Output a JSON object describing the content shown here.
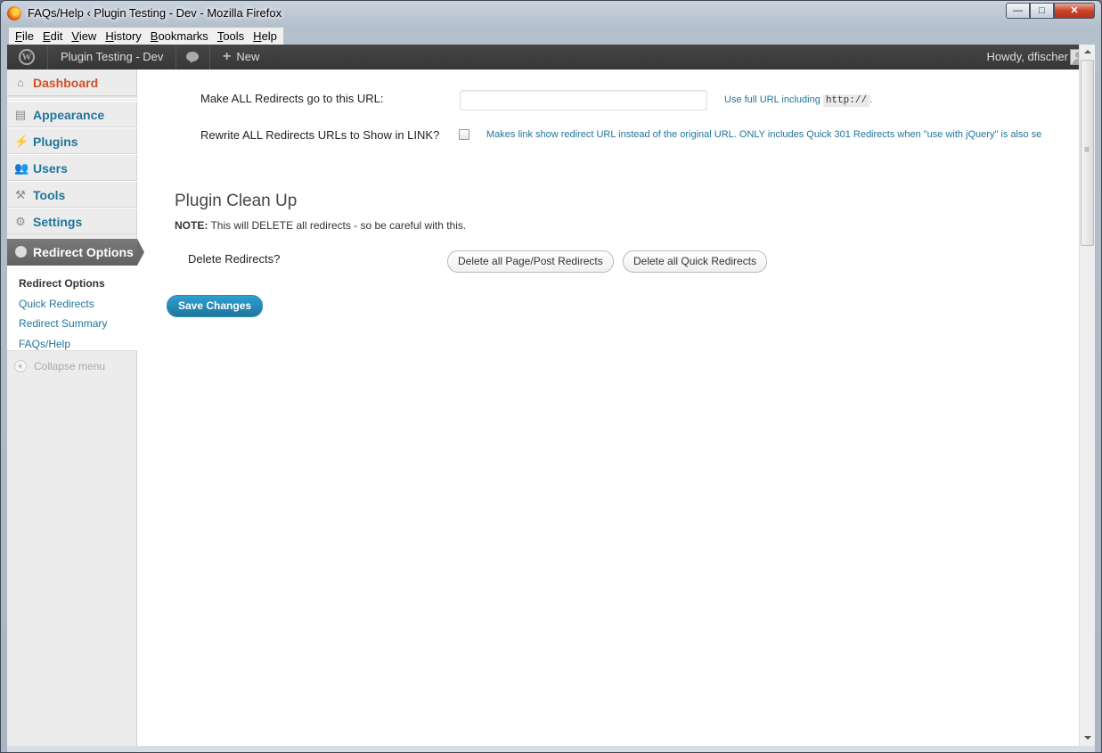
{
  "window": {
    "title": "FAQs/Help ‹ Plugin Testing - Dev - Mozilla Firefox",
    "minimize": "—",
    "maximize": "□",
    "close": "✕"
  },
  "menubar": [
    "File",
    "Edit",
    "View",
    "History",
    "Bookmarks",
    "Tools",
    "Help"
  ],
  "adminbar": {
    "site_name": "Plugin Testing - Dev",
    "new_label": "New",
    "howdy": "Howdy, dfischer"
  },
  "sidebar": {
    "dashboard": "Dashboard",
    "appearance": "Appearance",
    "plugins": "Plugins",
    "users": "Users",
    "tools": "Tools",
    "settings": "Settings",
    "current": "Redirect Options",
    "submenu": [
      "Redirect Options",
      "Quick Redirects",
      "Redirect Summary",
      "FAQs/Help"
    ],
    "collapse": "Collapse menu"
  },
  "form": {
    "all_redirects_label": "Make ALL Redirects go to this URL:",
    "all_redirects_value": "",
    "all_redirects_hint_pre": "Use full URL including",
    "all_redirects_hint_code": "http://",
    "all_redirects_hint_post": ".",
    "rewrite_label": "Rewrite ALL Redirects URLs to Show in LINK?",
    "rewrite_checked": false,
    "rewrite_hint": "Makes link show redirect URL instead of the original URL. ONLY includes Quick 301 Redirects when \"use with jQuery\" is also se"
  },
  "cleanup": {
    "title": "Plugin Clean Up",
    "note_bold": "NOTE:",
    "note_text": " This will DELETE all redirects - so be careful with this.",
    "delete_label": "Delete Redirects?",
    "btn_page_post": "Delete all Page/Post Redirects",
    "btn_quick": "Delete all Quick Redirects"
  },
  "save_button": "Save Changes",
  "colors": {
    "link": "#21759b",
    "dashboard_active": "#d54e21",
    "adminbar_bg": "#464646",
    "primary_button": "#21759b"
  }
}
